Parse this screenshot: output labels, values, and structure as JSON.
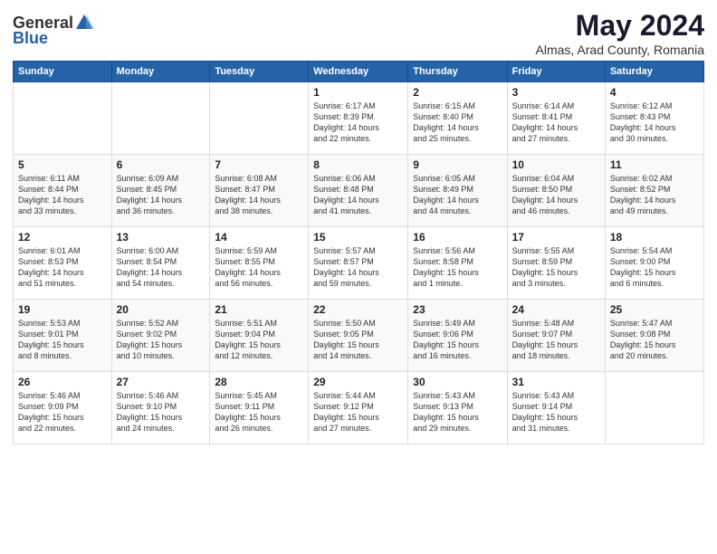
{
  "header": {
    "logo_general": "General",
    "logo_blue": "Blue",
    "month_title": "May 2024",
    "location": "Almas, Arad County, Romania"
  },
  "weekdays": [
    "Sunday",
    "Monday",
    "Tuesday",
    "Wednesday",
    "Thursday",
    "Friday",
    "Saturday"
  ],
  "weeks": [
    [
      {
        "day": "",
        "info": ""
      },
      {
        "day": "",
        "info": ""
      },
      {
        "day": "",
        "info": ""
      },
      {
        "day": "1",
        "info": "Sunrise: 6:17 AM\nSunset: 8:39 PM\nDaylight: 14 hours\nand 22 minutes."
      },
      {
        "day": "2",
        "info": "Sunrise: 6:15 AM\nSunset: 8:40 PM\nDaylight: 14 hours\nand 25 minutes."
      },
      {
        "day": "3",
        "info": "Sunrise: 6:14 AM\nSunset: 8:41 PM\nDaylight: 14 hours\nand 27 minutes."
      },
      {
        "day": "4",
        "info": "Sunrise: 6:12 AM\nSunset: 8:43 PM\nDaylight: 14 hours\nand 30 minutes."
      }
    ],
    [
      {
        "day": "5",
        "info": "Sunrise: 6:11 AM\nSunset: 8:44 PM\nDaylight: 14 hours\nand 33 minutes."
      },
      {
        "day": "6",
        "info": "Sunrise: 6:09 AM\nSunset: 8:45 PM\nDaylight: 14 hours\nand 36 minutes."
      },
      {
        "day": "7",
        "info": "Sunrise: 6:08 AM\nSunset: 8:47 PM\nDaylight: 14 hours\nand 38 minutes."
      },
      {
        "day": "8",
        "info": "Sunrise: 6:06 AM\nSunset: 8:48 PM\nDaylight: 14 hours\nand 41 minutes."
      },
      {
        "day": "9",
        "info": "Sunrise: 6:05 AM\nSunset: 8:49 PM\nDaylight: 14 hours\nand 44 minutes."
      },
      {
        "day": "10",
        "info": "Sunrise: 6:04 AM\nSunset: 8:50 PM\nDaylight: 14 hours\nand 46 minutes."
      },
      {
        "day": "11",
        "info": "Sunrise: 6:02 AM\nSunset: 8:52 PM\nDaylight: 14 hours\nand 49 minutes."
      }
    ],
    [
      {
        "day": "12",
        "info": "Sunrise: 6:01 AM\nSunset: 8:53 PM\nDaylight: 14 hours\nand 51 minutes."
      },
      {
        "day": "13",
        "info": "Sunrise: 6:00 AM\nSunset: 8:54 PM\nDaylight: 14 hours\nand 54 minutes."
      },
      {
        "day": "14",
        "info": "Sunrise: 5:59 AM\nSunset: 8:55 PM\nDaylight: 14 hours\nand 56 minutes."
      },
      {
        "day": "15",
        "info": "Sunrise: 5:57 AM\nSunset: 8:57 PM\nDaylight: 14 hours\nand 59 minutes."
      },
      {
        "day": "16",
        "info": "Sunrise: 5:56 AM\nSunset: 8:58 PM\nDaylight: 15 hours\nand 1 minute."
      },
      {
        "day": "17",
        "info": "Sunrise: 5:55 AM\nSunset: 8:59 PM\nDaylight: 15 hours\nand 3 minutes."
      },
      {
        "day": "18",
        "info": "Sunrise: 5:54 AM\nSunset: 9:00 PM\nDaylight: 15 hours\nand 6 minutes."
      }
    ],
    [
      {
        "day": "19",
        "info": "Sunrise: 5:53 AM\nSunset: 9:01 PM\nDaylight: 15 hours\nand 8 minutes."
      },
      {
        "day": "20",
        "info": "Sunrise: 5:52 AM\nSunset: 9:02 PM\nDaylight: 15 hours\nand 10 minutes."
      },
      {
        "day": "21",
        "info": "Sunrise: 5:51 AM\nSunset: 9:04 PM\nDaylight: 15 hours\nand 12 minutes."
      },
      {
        "day": "22",
        "info": "Sunrise: 5:50 AM\nSunset: 9:05 PM\nDaylight: 15 hours\nand 14 minutes."
      },
      {
        "day": "23",
        "info": "Sunrise: 5:49 AM\nSunset: 9:06 PM\nDaylight: 15 hours\nand 16 minutes."
      },
      {
        "day": "24",
        "info": "Sunrise: 5:48 AM\nSunset: 9:07 PM\nDaylight: 15 hours\nand 18 minutes."
      },
      {
        "day": "25",
        "info": "Sunrise: 5:47 AM\nSunset: 9:08 PM\nDaylight: 15 hours\nand 20 minutes."
      }
    ],
    [
      {
        "day": "26",
        "info": "Sunrise: 5:46 AM\nSunset: 9:09 PM\nDaylight: 15 hours\nand 22 minutes."
      },
      {
        "day": "27",
        "info": "Sunrise: 5:46 AM\nSunset: 9:10 PM\nDaylight: 15 hours\nand 24 minutes."
      },
      {
        "day": "28",
        "info": "Sunrise: 5:45 AM\nSunset: 9:11 PM\nDaylight: 15 hours\nand 26 minutes."
      },
      {
        "day": "29",
        "info": "Sunrise: 5:44 AM\nSunset: 9:12 PM\nDaylight: 15 hours\nand 27 minutes."
      },
      {
        "day": "30",
        "info": "Sunrise: 5:43 AM\nSunset: 9:13 PM\nDaylight: 15 hours\nand 29 minutes."
      },
      {
        "day": "31",
        "info": "Sunrise: 5:43 AM\nSunset: 9:14 PM\nDaylight: 15 hours\nand 31 minutes."
      },
      {
        "day": "",
        "info": ""
      }
    ]
  ]
}
